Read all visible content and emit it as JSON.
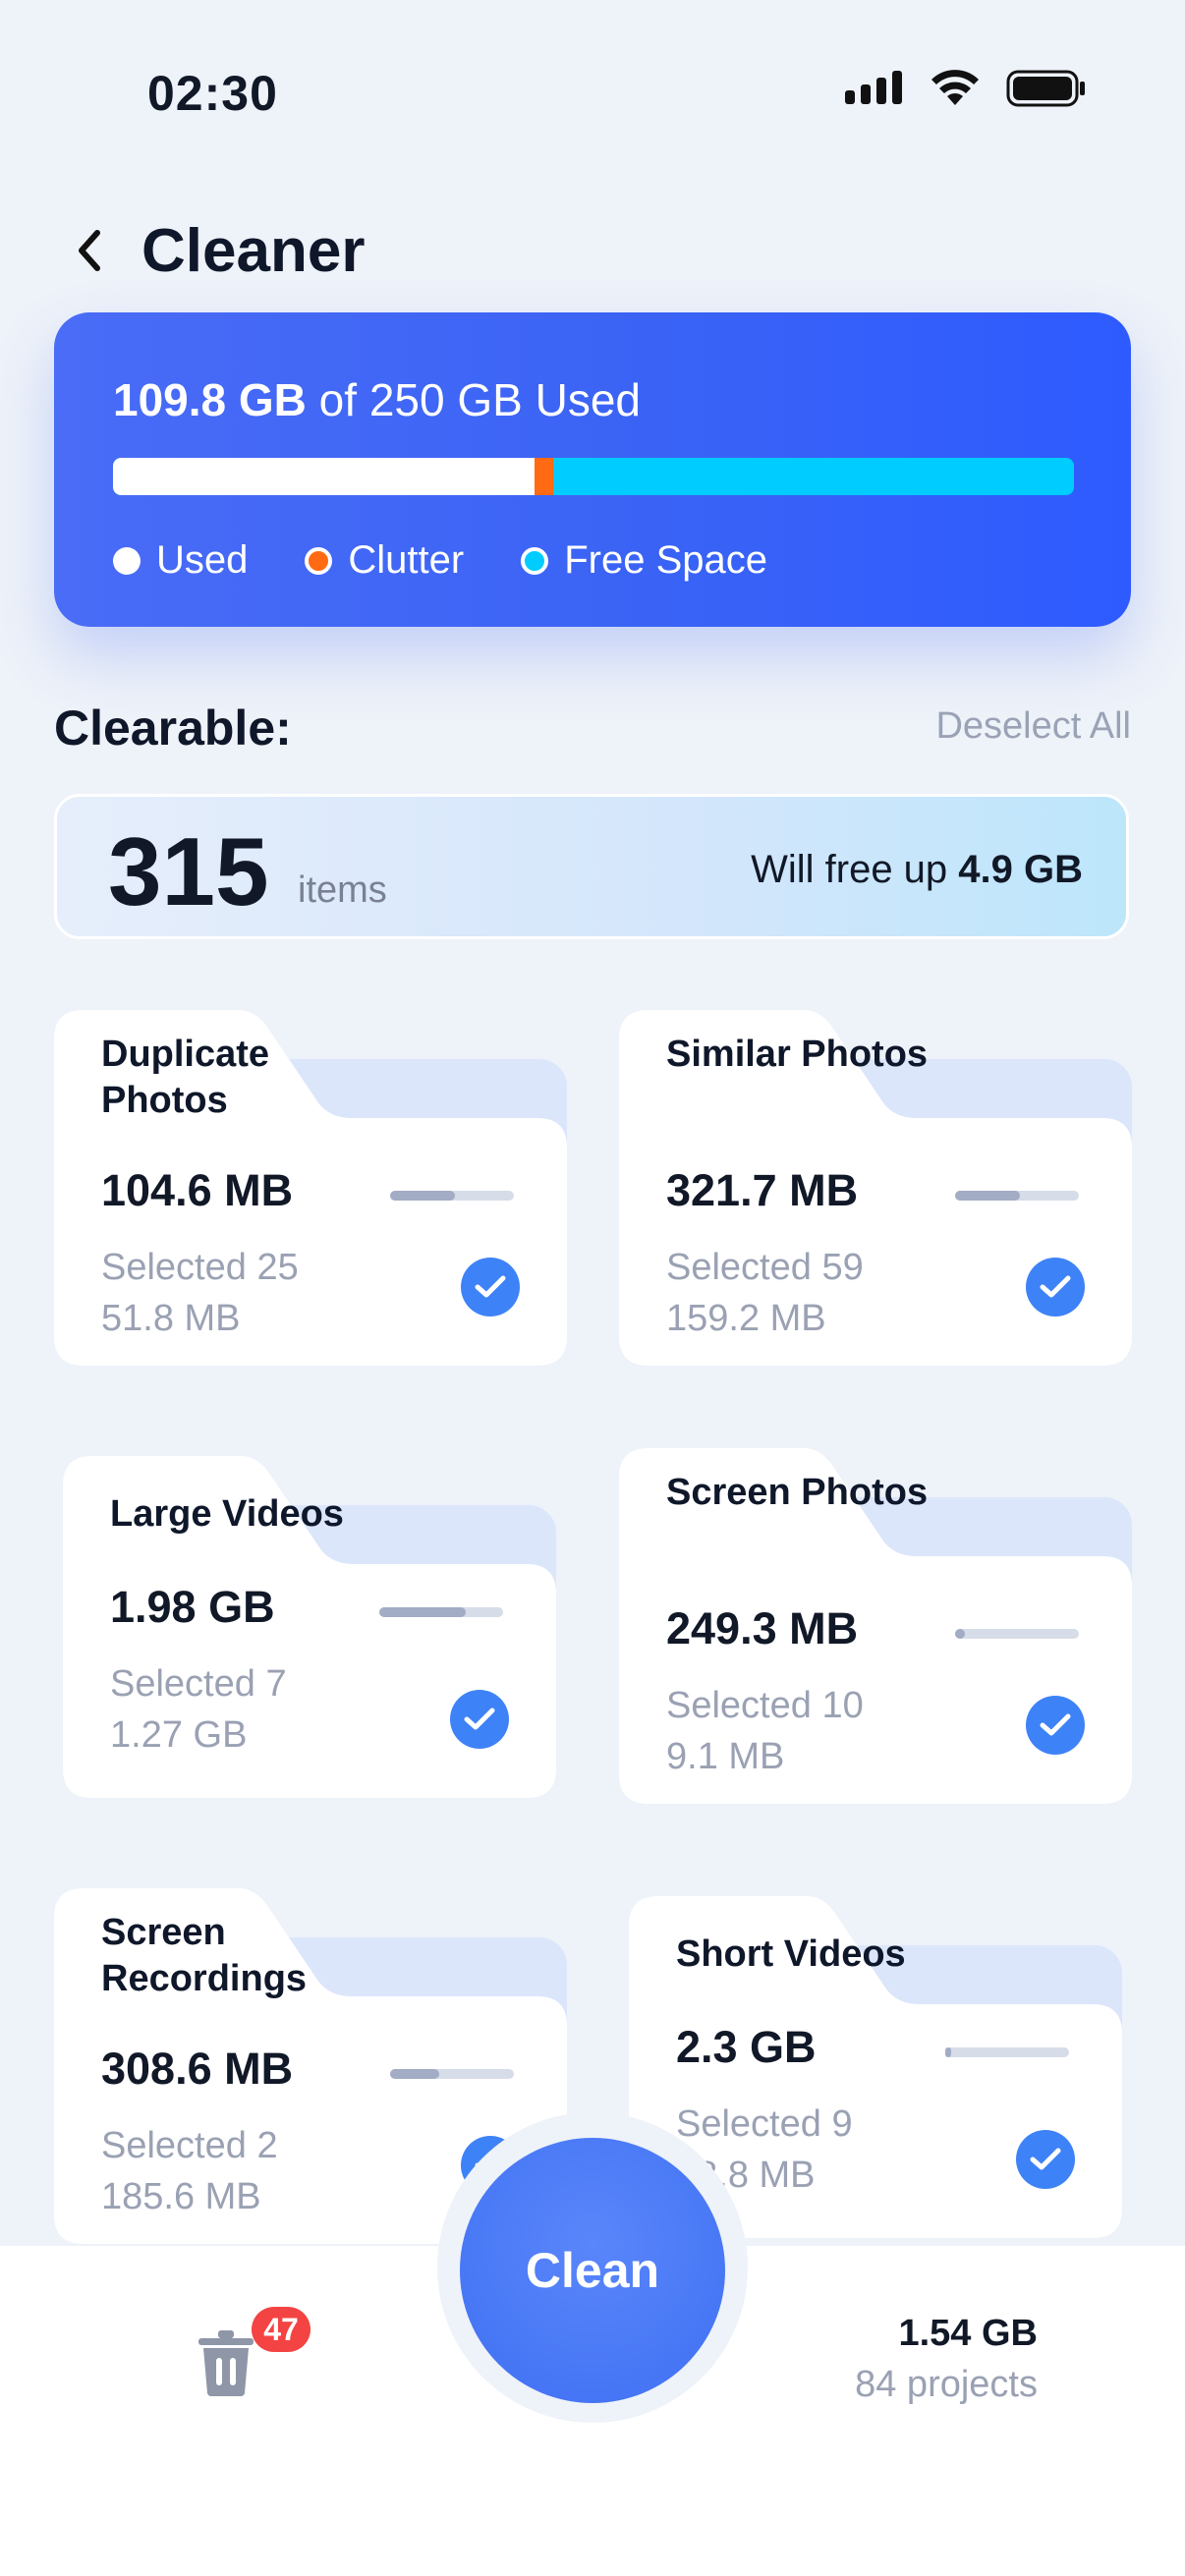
{
  "status_bar": {
    "time": "02:30"
  },
  "header": {
    "title": "Cleaner"
  },
  "storage": {
    "used_value": "109.8 GB",
    "of_total": " of 250 GB Used",
    "used_fraction": 0.439,
    "clutter_fraction": 0.019,
    "legend": {
      "used": "Used",
      "clutter": "Clutter",
      "free": "Free Space"
    },
    "colors": {
      "used": "#FFFFFF",
      "clutter": "#FF6A13",
      "free": "#00CCFF"
    }
  },
  "clearable": {
    "label": "Clearable:",
    "deselect_label": "Deselect All",
    "count": "315",
    "count_unit": "items",
    "free_prefix": "Will free up ",
    "free_value": "4.9 GB"
  },
  "categories": [
    {
      "title": "Duplicate Photos",
      "size": "104.6 MB",
      "selected": "Selected 25",
      "selected_size": "51.8 MB",
      "fill": 0.52,
      "checked": true
    },
    {
      "title": "Similar Photos",
      "size": "321.7 MB",
      "selected": "Selected 59",
      "selected_size": "159.2 MB",
      "fill": 0.52,
      "checked": true
    },
    {
      "title": "Large Videos",
      "size": "1.98 GB",
      "selected": "Selected 7",
      "selected_size": "1.27 GB",
      "fill": 0.7,
      "checked": true
    },
    {
      "title": "Screen Photos",
      "size": "249.3 MB",
      "selected": "Selected 10",
      "selected_size": "9.1 MB",
      "fill": 0.08,
      "checked": true
    },
    {
      "title": "Screen Recordings",
      "size": "308.6 MB",
      "selected": "Selected 2",
      "selected_size": "185.6 MB",
      "fill": 0.4,
      "checked": true
    },
    {
      "title": "Short Videos",
      "size": "2.3 GB",
      "selected": "Selected 9",
      "selected_size": "98.8 MB",
      "fill": 0.05,
      "checked": true
    }
  ],
  "bottom": {
    "clean_label": "Clean",
    "trash_badge": "47",
    "projects_size": "1.54 GB",
    "projects_count": "84 projects"
  },
  "accent": "#3E82F7"
}
